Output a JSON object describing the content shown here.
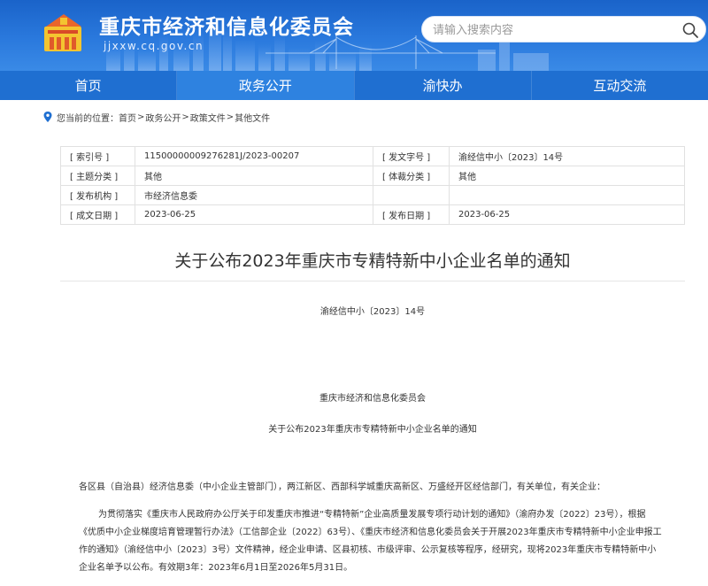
{
  "header": {
    "site_title": "重庆市经济和信息化委员会",
    "site_domain": "jjxxw.cq.gov.cn",
    "search_placeholder": "请输入搜索内容",
    "colors": {
      "banner": "#2a79dd",
      "nav": "#1f6fd1",
      "nav_active": "#2e82e0"
    }
  },
  "nav": {
    "items": [
      {
        "label": "首页"
      },
      {
        "label": "政务公开"
      },
      {
        "label": "渝快办"
      },
      {
        "label": "互动交流"
      }
    ],
    "active_index": 1
  },
  "breadcrumb": {
    "prefix": "您当前的位置：",
    "items": [
      "首页",
      "政务公开",
      "政策文件",
      "其他文件"
    ],
    "separator": ">"
  },
  "info_table": {
    "rows": [
      {
        "label1": "[ 索引号 ]",
        "value1": "11500000009276281J/2023-00207",
        "label2": "[ 发文字号 ]",
        "value2": "渝经信中小〔2023〕14号"
      },
      {
        "label1": "[ 主题分类 ]",
        "value1": "其他",
        "label2": "[ 体裁分类 ]",
        "value2": "其他"
      },
      {
        "label1": "[ 发布机构 ]",
        "value1": "市经济信息委",
        "label2": "",
        "value2": ""
      },
      {
        "label1": "[ 成文日期 ]",
        "value1": "2023-06-25",
        "label2": "[ 发布日期 ]",
        "value2": "2023-06-25"
      }
    ]
  },
  "article": {
    "title": "关于公布2023年重庆市专精特新中小企业名单的通知",
    "doc_number": "渝经信中小〔2023〕14号",
    "issuer": "重庆市经济和信息化委员会",
    "notice_name": "关于公布2023年重庆市专精特新中小企业名单的通知",
    "salutation": "各区县（自治县）经济信息委（中小企业主管部门），两江新区、西部科学城重庆高新区、万盛经开区经信部门，有关单位，有关企业：",
    "body": "为贯彻落实《重庆市人民政府办公厅关于印发重庆市推进“专精特新”企业高质量发展专项行动计划的通知》（渝府办发〔2022〕23号），根据《优质中小企业梯度培育管理暂行办法》（工信部企业〔2022〕63号）、《重庆市经济和信息化委员会关于开展2023年重庆市专精特新中小企业申报工作的通知》（渝经信中小〔2023〕3号）文件精神，经企业申请、区县初核、市级评审、公示复核等程序，经研究，现将2023年重庆市专精特新中小企业名单予以公布。有效期3年：2023年6月1日至2026年5月31日。"
  }
}
